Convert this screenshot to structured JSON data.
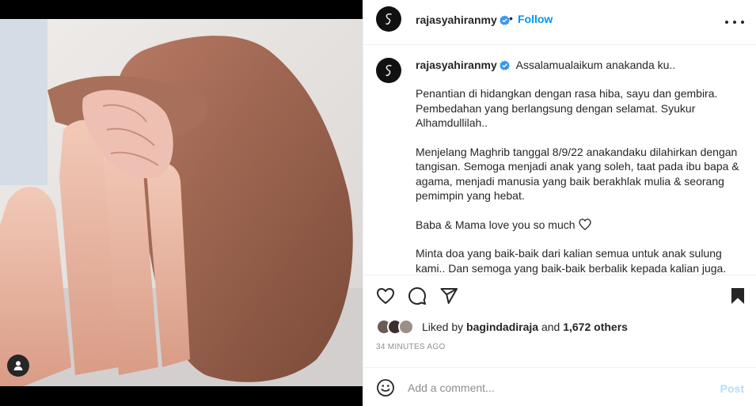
{
  "post": {
    "username": "rajasyahiranmy",
    "follow_label": "Follow",
    "separator": "•",
    "caption_first_line": "Assalamualaikum anakanda ku..",
    "caption_paragraphs": [
      "Penantian di hidangkan dengan rasa hiba, sayu dan gembira. Pembedahan yang berlangsung dengan selamat. Syukur Alhamdullilah..",
      "Menjelang Maghrib tanggal 8/9/22 anakandaku dilahirkan dengan tangisan. Semoga menjadi anak yang soleh, taat pada ibu bapa & agama, menjadi manusia yang baik berakhlak mulia & seorang pemimpin yang hebat.",
      "Baba & Mama love you so much",
      "Minta doa yang baik-baik dari kalian semua untuk anak sulung kami.. Dan semoga yang baik-baik berbalik kepada kalian juga."
    ],
    "likes": {
      "prefix": "Liked by",
      "first_liker": "bagindadiraja",
      "connector": "and",
      "others": "1,672 others"
    },
    "timestamp": "34 minutes ago",
    "comment": {
      "placeholder": "Add a comment...",
      "post_label": "Post"
    }
  },
  "icons": {
    "header_more": "more-icon",
    "verified": "verified-badge-icon",
    "like": "heart-icon",
    "comment": "comment-icon",
    "share": "share-icon",
    "save": "bookmark-icon",
    "emoji": "emoji-icon",
    "tag": "user-tag-icon"
  },
  "colors": {
    "accent": "#0095f6",
    "verified": "#3897f0",
    "post_disabled": "#b2dffc",
    "muted": "#8e8e8e",
    "text": "#262626"
  }
}
